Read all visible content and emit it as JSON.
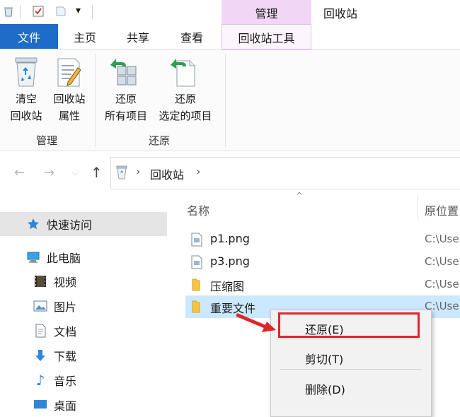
{
  "title_bar": {
    "context_group_label": "管理",
    "window_title": "回收站",
    "qat_dropdown": "▾"
  },
  "tabs": {
    "file": "文件",
    "home": "主页",
    "share": "共享",
    "view": "查看",
    "recycle_tools": "回收站工具"
  },
  "ribbon": {
    "groups": [
      {
        "label": "管理",
        "buttons": [
          {
            "line1": "清空",
            "line2": "回收站"
          },
          {
            "line1": "回收站",
            "line2": "属性"
          }
        ]
      },
      {
        "label": "还原",
        "buttons": [
          {
            "line1": "还原",
            "line2": "所有项目"
          },
          {
            "line1": "还原",
            "line2": "选定的项目"
          }
        ]
      }
    ]
  },
  "address": {
    "breadcrumb_sep": "›",
    "location": "回收站",
    "trailing_chevron": "›"
  },
  "columns": {
    "name": "名称",
    "original_location": "原位置"
  },
  "nav_pane": {
    "quick_access": "快速访问",
    "this_pc": "此电脑",
    "items": [
      "视频",
      "图片",
      "文档",
      "下载",
      "音乐",
      "桌面"
    ]
  },
  "files": [
    {
      "name": "p1.png",
      "location": "C:\\Use",
      "type": "image"
    },
    {
      "name": "p3.png",
      "location": "C:\\Use",
      "type": "image"
    },
    {
      "name": "压缩图",
      "location": "C:\\Use",
      "type": "folder"
    },
    {
      "name": "重要文件",
      "location": "C:\\Use",
      "type": "folder",
      "selected": true
    }
  ],
  "context_menu": {
    "items": [
      "还原(E)",
      "剪切(T)",
      "删除(D)"
    ],
    "highlighted": "还原(E)"
  },
  "colors": {
    "file_tab": "#1e6cc8",
    "context_tab": "#f1d7f5",
    "selected_row": "#cce8ff",
    "callout": "#e0262a"
  }
}
